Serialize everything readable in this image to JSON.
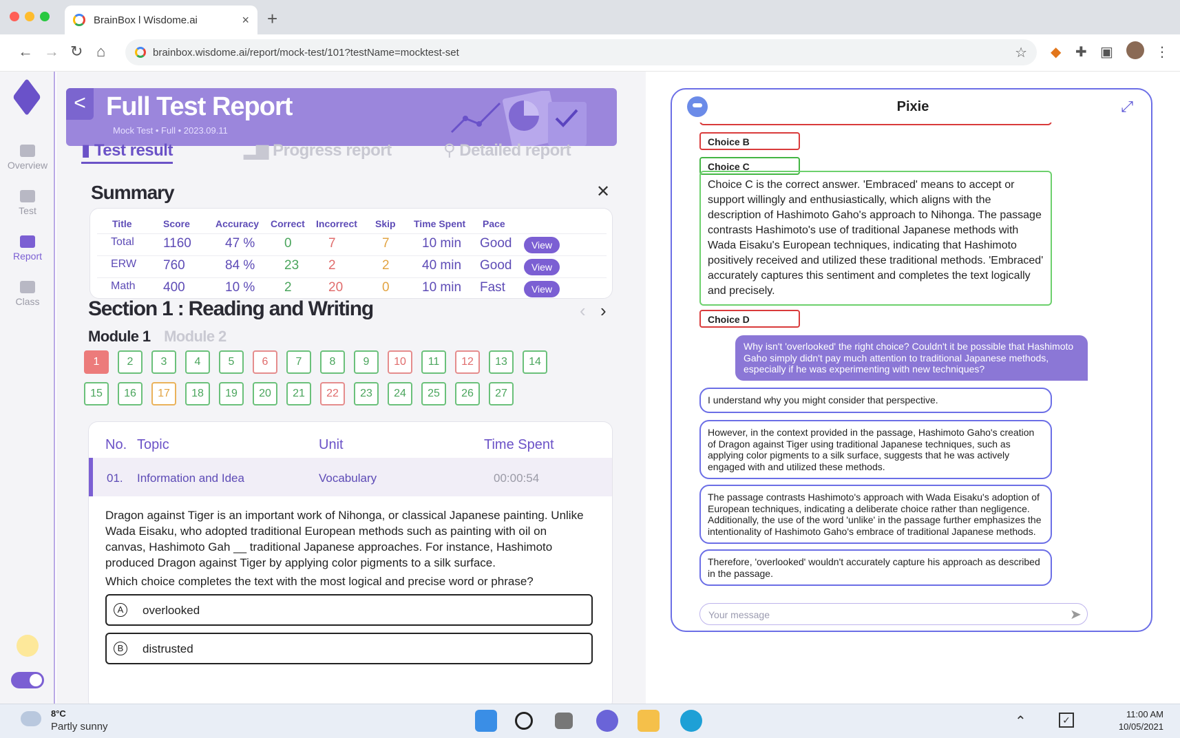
{
  "browser": {
    "tab_title": "BrainBox l Wisdome.ai",
    "tab_close": "×",
    "new_tab": "+",
    "url": "brainbox.wisdome.ai/report/mock-test/101?testName=mocktest-set"
  },
  "sidebar": {
    "items": [
      {
        "label": "Overview"
      },
      {
        "label": "Test"
      },
      {
        "label": "Report"
      },
      {
        "label": "Class"
      }
    ],
    "active": "Report"
  },
  "banner": {
    "back": "<",
    "title": "Full Test Report",
    "meta": "Mock Test   •   Full   •   2023.09.11"
  },
  "report_tabs": [
    "Test result",
    "Progress report",
    "Detailed report"
  ],
  "summary": {
    "heading": "Summary",
    "close": "✕",
    "columns": [
      "Title",
      "Score",
      "Accuracy",
      "Correct",
      "Incorrect",
      "Skip",
      "Time Spent",
      "Pace"
    ],
    "view_label": "View",
    "rows": [
      {
        "title": "Total",
        "score": "1160",
        "accuracy": "47 %",
        "correct": "0",
        "incorrect": "7",
        "skip": "7",
        "time": "10 min",
        "pace": "Good"
      },
      {
        "title": "ERW",
        "score": "760",
        "accuracy": "84 %",
        "correct": "23",
        "incorrect": "2",
        "skip": "2",
        "time": "40 min",
        "pace": "Good"
      },
      {
        "title": "Math",
        "score": "400",
        "accuracy": "10 %",
        "correct": "2",
        "incorrect": "20",
        "skip": "0",
        "time": "10 min",
        "pace": "Fast"
      }
    ]
  },
  "section": {
    "heading": "Section 1 : Reading and Writing",
    "prev": "‹",
    "next": "›",
    "modules": [
      "Module 1",
      "Module 2"
    ],
    "questions_row1": [
      {
        "n": "1",
        "status": "filled"
      },
      {
        "n": "2",
        "status": "green"
      },
      {
        "n": "3",
        "status": "green"
      },
      {
        "n": "4",
        "status": "green"
      },
      {
        "n": "5",
        "status": "green"
      },
      {
        "n": "6",
        "status": "red"
      },
      {
        "n": "7",
        "status": "green"
      },
      {
        "n": "8",
        "status": "green"
      },
      {
        "n": "9",
        "status": "green"
      },
      {
        "n": "10",
        "status": "red"
      },
      {
        "n": "11",
        "status": "green"
      },
      {
        "n": "12",
        "status": "red"
      },
      {
        "n": "13",
        "status": "green"
      },
      {
        "n": "14",
        "status": "green"
      }
    ],
    "questions_row2": [
      {
        "n": "15",
        "status": "green"
      },
      {
        "n": "16",
        "status": "green"
      },
      {
        "n": "17",
        "status": "orange"
      },
      {
        "n": "18",
        "status": "green"
      },
      {
        "n": "19",
        "status": "green"
      },
      {
        "n": "20",
        "status": "green"
      },
      {
        "n": "21",
        "status": "green"
      },
      {
        "n": "22",
        "status": "red"
      },
      {
        "n": "23",
        "status": "green"
      },
      {
        "n": "24",
        "status": "green"
      },
      {
        "n": "25",
        "status": "green"
      },
      {
        "n": "26",
        "status": "green"
      },
      {
        "n": "27",
        "status": "green"
      }
    ]
  },
  "detail": {
    "headers": {
      "no": "No.",
      "topic": "Topic",
      "unit": "Unit",
      "time": "Time Spent"
    },
    "row": {
      "no": "01.",
      "topic": "Information and Idea",
      "unit": "Vocabulary",
      "time": "00:00:54"
    },
    "passage": "Dragon against Tiger is an important work of Nihonga, or classical Japanese painting. Unlike Wada Eisaku, who adopted traditional European methods such as painting with oil on canvas, Hashimoto Gah __ traditional Japanese approaches. For instance, Hashimoto produced Dragon against Tiger by applying color pigments to a silk surface.",
    "question": "Which choice completes the text with the most logical and precise word or phrase?",
    "options": [
      {
        "letter": "A",
        "text": "overlooked"
      },
      {
        "letter": "B",
        "text": "distrusted"
      }
    ]
  },
  "pixie": {
    "title": "Pixie",
    "choice_b": "Choice B",
    "choice_c": "Choice C",
    "choice_c_text": "Choice C is the correct answer. 'Embraced' means to accept or support willingly and enthusiastically, which aligns with the description of Hashimoto Gaho's approach to Nihonga. The passage contrasts Hashimoto's use of traditional Japanese methods with Wada Eisaku's European techniques, indicating that Hashimoto positively received and utilized these traditional methods. 'Embraced' accurately captures this sentiment and completes the text logically and precisely.",
    "choice_d": "Choice D",
    "user_msg": "Why isn't 'overlooked' the right choice? Couldn't it be possible that Hashimoto Gaho simply didn't pay much attention to traditional Japanese methods, especially if he was experimenting with new techniques?",
    "replies": [
      "I understand why you might consider that perspective.",
      "However, in the context provided in the passage, Hashimoto Gaho's creation of Dragon against Tiger using traditional Japanese techniques, such as applying color pigments to a silk surface, suggests that he was actively engaged with and utilized these methods.",
      "The passage contrasts Hashimoto's approach with Wada Eisaku's adoption of European techniques, indicating a deliberate choice rather than negligence. Additionally, the use of the word 'unlike' in the passage further emphasizes the intentionality of Hashimoto Gaho's embrace of traditional Japanese methods.",
      "Therefore, 'overlooked' wouldn't accurately capture his approach as described in the passage."
    ],
    "input_placeholder": "Your message"
  },
  "taskbar": {
    "temp": "8°C",
    "condition": "Partly sunny",
    "time": "11:00 AM",
    "date": "10/05/2021"
  },
  "colors": {
    "accent": "#7b5fd3",
    "correct": "#4aa55c",
    "incorrect": "#e06c6c",
    "skip": "#e2a443"
  }
}
